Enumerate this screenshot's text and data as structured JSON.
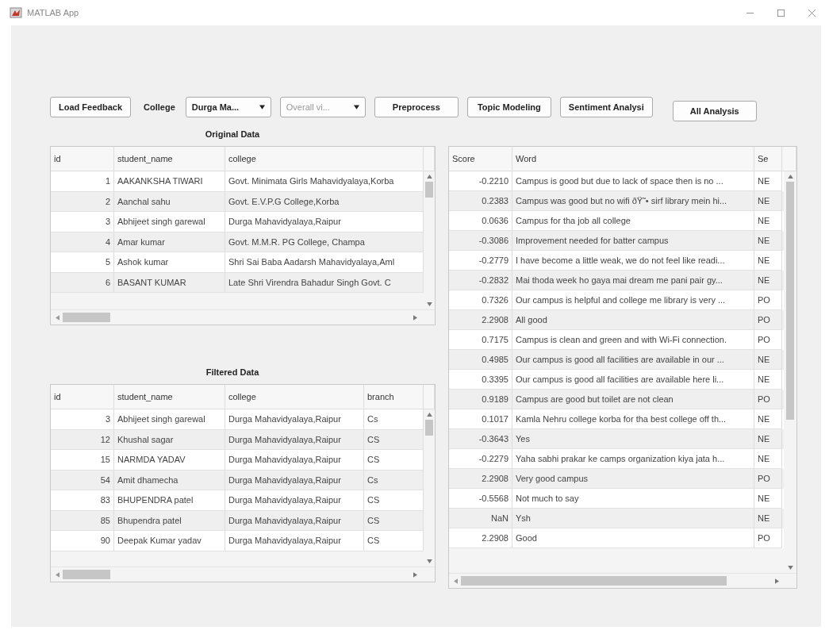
{
  "window": {
    "title": "MATLAB App"
  },
  "toolbar": [
    {
      "kind": "button",
      "label": "Load Feedback"
    },
    {
      "kind": "label",
      "label": "College"
    },
    {
      "kind": "dropdown",
      "value": "Durga Ma...",
      "disabled": false
    },
    {
      "kind": "dropdown",
      "value": "Overall vi...",
      "disabled": true
    },
    {
      "kind": "button",
      "label": "Preprocess"
    },
    {
      "kind": "button",
      "label": "Topic Modeling"
    },
    {
      "kind": "button",
      "label": "Sentiment Analysi"
    },
    {
      "kind": "button",
      "label": "All Analysis"
    }
  ],
  "original_data": {
    "title": "Original Data",
    "columns": [
      "id",
      "student_name",
      "college"
    ],
    "rows": [
      [
        "1",
        "AAKANKSHA TIWARI",
        "Govt. Minimata Girls Mahavidyalaya,Korba"
      ],
      [
        "2",
        "Aanchal sahu",
        "Govt. E.V.P.G College,Korba"
      ],
      [
        "3",
        "Abhijeet singh garewal",
        "Durga Mahavidyalaya,Raipur"
      ],
      [
        "4",
        "Amar kumar",
        "Govt. M.M.R. PG College, Champa"
      ],
      [
        "5",
        "Ashok kumar",
        "Shri Sai Baba Aadarsh Mahavidyalaya,Aml"
      ],
      [
        "6",
        "BASANT KUMAR",
        "Late Shri Virendra Bahadur Singh Govt. C"
      ]
    ]
  },
  "filtered_data": {
    "title": "Filtered Data",
    "columns": [
      "id",
      "student_name",
      "college",
      "branch"
    ],
    "rows": [
      [
        "3",
        "Abhijeet singh garewal",
        "Durga Mahavidyalaya,Raipur",
        "Cs"
      ],
      [
        "12",
        "Khushal sagar",
        "Durga Mahavidyalaya,Raipur",
        "CS"
      ],
      [
        "15",
        "NARMDA YADAV",
        "Durga Mahavidyalaya,Raipur",
        "CS"
      ],
      [
        "54",
        "Amit dhamecha",
        "Durga Mahavidyalaya,Raipur",
        "Cs"
      ],
      [
        "83",
        "BHUPENDRA patel",
        "Durga Mahavidyalaya,Raipur",
        "CS"
      ],
      [
        "85",
        "Bhupendra patel",
        "Durga Mahavidyalaya,Raipur",
        "CS"
      ],
      [
        "90",
        "Deepak Kumar yadav",
        "Durga Mahavidyalaya,Raipur",
        "CS"
      ]
    ]
  },
  "sentiment_table": {
    "columns": [
      "Score",
      "Word",
      "Se"
    ],
    "rows": [
      [
        "-0.2210",
        "Campus is good but due to lack of space then is no ...",
        "NE"
      ],
      [
        "0.2383",
        "Campus was good but no wifi ðŸ˜• sirf library mein hi...",
        "NE"
      ],
      [
        "0.0636",
        "Campus for tha job all college",
        "NE"
      ],
      [
        "-0.3086",
        "Improvement needed for batter campus",
        "NE"
      ],
      [
        "-0.2779",
        "I have become a little weak, we do not feel like readi...",
        "NE"
      ],
      [
        "-0.2832",
        "Mai thoda week ho gaya mai dream me pani pair gy...",
        "NE"
      ],
      [
        "0.7326",
        "Our campus is helpful and college me library is very ...",
        "PO"
      ],
      [
        "2.2908",
        "All good",
        "PO"
      ],
      [
        "0.7175",
        "Campus is clean and green and with Wi-Fi connection.",
        "PO"
      ],
      [
        "0.4985",
        "Our campus is good all facilities are available in our ...",
        "NE"
      ],
      [
        "0.3395",
        "Our campus is good all facilities are available here li...",
        "NE"
      ],
      [
        "0.9189",
        "Campus are good but toilet are not clean",
        "PO"
      ],
      [
        "0.1017",
        "Kamla Nehru college korba for tha best college off th...",
        "NE"
      ],
      [
        "-0.3643",
        "Yes",
        "NE"
      ],
      [
        "-0.2279",
        "Yaha sabhi prakar ke camps organization kiya jata h...",
        "NE"
      ],
      [
        "2.2908",
        "Very good campus",
        "PO"
      ],
      [
        "-0.5568",
        "Not much to say",
        "NE"
      ],
      [
        "NaN",
        "Ysh",
        "NE"
      ],
      [
        "2.2908",
        "Good",
        "PO"
      ]
    ]
  }
}
